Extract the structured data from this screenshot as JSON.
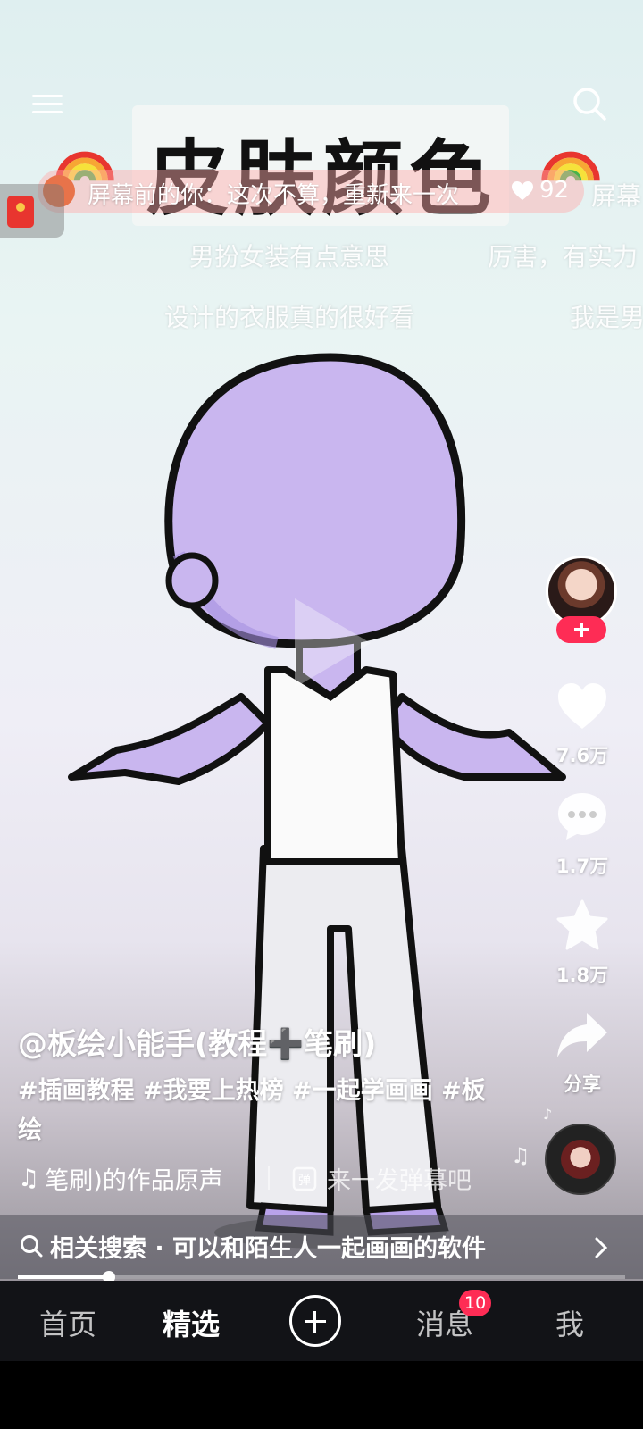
{
  "video": {
    "title_text": "皮肤颜色",
    "top_danmu": {
      "text": "屏幕前的你：这次不算，重新来一次",
      "likes": "92"
    },
    "danmu": [
      "屏幕",
      "男扮女装有点意思",
      "厉害，有实力",
      "设计的衣服真的很好看",
      "我是男"
    ]
  },
  "actions": {
    "likes": "7.6万",
    "comments": "1.7万",
    "favorites": "1.8万",
    "share": "分享"
  },
  "post": {
    "author": "@板绘小能手(教程➕笔刷)",
    "description": "#插画教程 #我要上热榜 #一起学画画 #板绘",
    "music": "笔刷)的作品原声",
    "danmu_input_placeholder": "来一发弹幕吧"
  },
  "related_search": {
    "text": "相关搜索 · 可以和陌生人一起画画的软件"
  },
  "progress": {
    "fraction": 0.15
  },
  "tabs": {
    "home": "首页",
    "featured": "精选",
    "messages": "消息",
    "me": "我",
    "messages_badge": "10"
  },
  "colors": {
    "accent": "#fe2c55",
    "tabbar": "#121317",
    "figure_skin": "#c9b6ef"
  },
  "icons": [
    "menu-icon",
    "search-icon",
    "red-packet-icon",
    "heart-icon",
    "comment-icon",
    "star-icon",
    "share-icon",
    "music-note-icon",
    "danmu-icon",
    "chevron-right-icon",
    "add-icon",
    "play-icon"
  ]
}
